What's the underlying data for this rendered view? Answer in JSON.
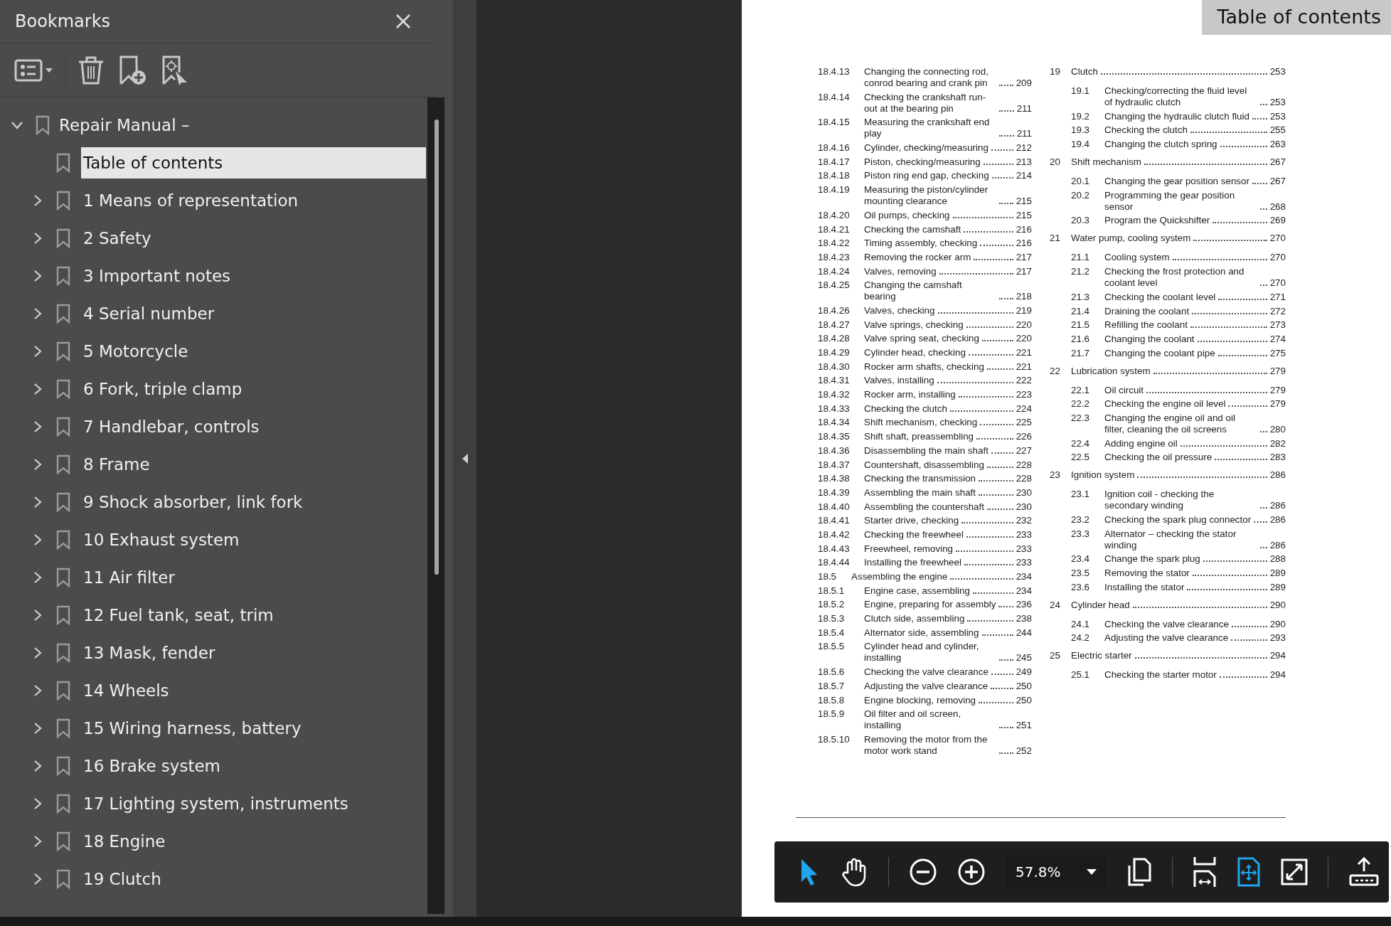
{
  "sidebar": {
    "title": "Bookmarks",
    "tree": [
      {
        "label": "Repair Manual –",
        "kind": "group",
        "expanded": true,
        "selected": false,
        "children": [
          {
            "label": "Table of contents",
            "kind": "leaf",
            "selected": true
          },
          {
            "label": "1 Means of representation",
            "kind": "group",
            "expanded": false,
            "selected": false
          },
          {
            "label": "2 Safety",
            "kind": "group",
            "expanded": false,
            "selected": false
          },
          {
            "label": "3 Important notes",
            "kind": "group",
            "expanded": false,
            "selected": false
          },
          {
            "label": "4 Serial number",
            "kind": "group",
            "expanded": false,
            "selected": false
          },
          {
            "label": "5 Motorcycle",
            "kind": "group",
            "expanded": false,
            "selected": false
          },
          {
            "label": "6 Fork, triple clamp",
            "kind": "group",
            "expanded": false,
            "selected": false
          },
          {
            "label": "7 Handlebar, controls",
            "kind": "group",
            "expanded": false,
            "selected": false
          },
          {
            "label": "8 Frame",
            "kind": "group",
            "expanded": false,
            "selected": false
          },
          {
            "label": "9 Shock absorber, link fork",
            "kind": "group",
            "expanded": false,
            "selected": false
          },
          {
            "label": "10 Exhaust system",
            "kind": "group",
            "expanded": false,
            "selected": false
          },
          {
            "label": "11 Air filter",
            "kind": "group",
            "expanded": false,
            "selected": false
          },
          {
            "label": "12 Fuel tank, seat, trim",
            "kind": "group",
            "expanded": false,
            "selected": false
          },
          {
            "label": "13 Mask, fender",
            "kind": "group",
            "expanded": false,
            "selected": false
          },
          {
            "label": "14 Wheels",
            "kind": "group",
            "expanded": false,
            "selected": false
          },
          {
            "label": "15 Wiring harness, battery",
            "kind": "group",
            "expanded": false,
            "selected": false
          },
          {
            "label": "16 Brake system",
            "kind": "group",
            "expanded": false,
            "selected": false
          },
          {
            "label": "17 Lighting system, instruments",
            "kind": "group",
            "expanded": false,
            "selected": false
          },
          {
            "label": "18 Engine",
            "kind": "group",
            "expanded": false,
            "selected": false
          },
          {
            "label": "19 Clutch",
            "kind": "group",
            "expanded": false,
            "selected": false
          }
        ]
      }
    ]
  },
  "document": {
    "page_tab": "Table of contents",
    "toc_left": [
      {
        "kind": "sub",
        "number": "18.4.13",
        "title": "Changing the connecting rod, conrod bearing and crank pin",
        "page": "209"
      },
      {
        "kind": "sub",
        "number": "18.4.14",
        "title": "Checking the crankshaft run-out at the bearing pin",
        "page": "211"
      },
      {
        "kind": "sub",
        "number": "18.4.15",
        "title": "Measuring the crankshaft end play",
        "page": "211"
      },
      {
        "kind": "sub",
        "number": "18.4.16",
        "title": "Cylinder, checking/measuring",
        "page": "212"
      },
      {
        "kind": "sub",
        "number": "18.4.17",
        "title": "Piston, checking/measuring",
        "page": "213"
      },
      {
        "kind": "sub",
        "number": "18.4.18",
        "title": "Piston ring end gap, checking",
        "page": "214"
      },
      {
        "kind": "sub",
        "number": "18.4.19",
        "title": "Measuring the piston/cylinder mounting clearance",
        "page": "215"
      },
      {
        "kind": "sub",
        "number": "18.4.20",
        "title": "Oil pumps, checking",
        "page": "215"
      },
      {
        "kind": "sub",
        "number": "18.4.21",
        "title": "Checking the camshaft",
        "page": "216"
      },
      {
        "kind": "sub",
        "number": "18.4.22",
        "title": "Timing assembly, checking",
        "page": "216"
      },
      {
        "kind": "sub",
        "number": "18.4.23",
        "title": "Removing the rocker arm",
        "page": "217"
      },
      {
        "kind": "sub",
        "number": "18.4.24",
        "title": "Valves, removing",
        "page": "217"
      },
      {
        "kind": "sub",
        "number": "18.4.25",
        "title": "Changing the camshaft bearing",
        "page": "218"
      },
      {
        "kind": "sub",
        "number": "18.4.26",
        "title": "Valves, checking",
        "page": "219"
      },
      {
        "kind": "sub",
        "number": "18.4.27",
        "title": "Valve springs, checking",
        "page": "220"
      },
      {
        "kind": "sub",
        "number": "18.4.28",
        "title": "Valve spring seat, checking",
        "page": "220"
      },
      {
        "kind": "sub",
        "number": "18.4.29",
        "title": "Cylinder head, checking",
        "page": "221"
      },
      {
        "kind": "sub",
        "number": "18.4.30",
        "title": "Rocker arm shafts, checking",
        "page": "221"
      },
      {
        "kind": "sub",
        "number": "18.4.31",
        "title": "Valves, installing",
        "page": "222"
      },
      {
        "kind": "sub",
        "number": "18.4.32",
        "title": "Rocker arm, installing",
        "page": "223"
      },
      {
        "kind": "sub",
        "number": "18.4.33",
        "title": "Checking the clutch",
        "page": "224"
      },
      {
        "kind": "sub",
        "number": "18.4.34",
        "title": "Shift mechanism, checking",
        "page": "225"
      },
      {
        "kind": "sub",
        "number": "18.4.35",
        "title": "Shift shaft, preassembling",
        "page": "226"
      },
      {
        "kind": "sub",
        "number": "18.4.36",
        "title": "Disassembling the main shaft",
        "page": "227"
      },
      {
        "kind": "sub",
        "number": "18.4.37",
        "title": "Countershaft, disassembling",
        "page": "228"
      },
      {
        "kind": "sub",
        "number": "18.4.38",
        "title": "Checking the transmission",
        "page": "228"
      },
      {
        "kind": "sub",
        "number": "18.4.39",
        "title": "Assembling the main shaft",
        "page": "230"
      },
      {
        "kind": "sub",
        "number": "18.4.40",
        "title": "Assembling the countershaft",
        "page": "230"
      },
      {
        "kind": "sub",
        "number": "18.4.41",
        "title": "Starter drive, checking",
        "page": "232"
      },
      {
        "kind": "sub",
        "number": "18.4.42",
        "title": "Checking the freewheel",
        "page": "233"
      },
      {
        "kind": "sub",
        "number": "18.4.43",
        "title": "Freewheel, removing",
        "page": "233"
      },
      {
        "kind": "sub",
        "number": "18.4.44",
        "title": "Installing the freewheel",
        "page": "233"
      },
      {
        "kind": "section",
        "number": "18.5",
        "title": "Assembling the engine",
        "page": "234"
      },
      {
        "kind": "sub",
        "number": "18.5.1",
        "title": "Engine case, assembling",
        "page": "234"
      },
      {
        "kind": "sub",
        "number": "18.5.2",
        "title": "Engine, preparing for assembly",
        "page": "236"
      },
      {
        "kind": "sub",
        "number": "18.5.3",
        "title": "Clutch side, assembling",
        "page": "238"
      },
      {
        "kind": "sub",
        "number": "18.5.4",
        "title": "Alternator side, assembling",
        "page": "244"
      },
      {
        "kind": "sub",
        "number": "18.5.5",
        "title": "Cylinder head and cylinder, installing",
        "page": "245"
      },
      {
        "kind": "sub",
        "number": "18.5.6",
        "title": "Checking the valve clearance",
        "page": "249"
      },
      {
        "kind": "sub",
        "number": "18.5.7",
        "title": "Adjusting the valve clearance",
        "page": "250"
      },
      {
        "kind": "sub",
        "number": "18.5.8",
        "title": "Engine blocking, removing",
        "page": "250"
      },
      {
        "kind": "sub",
        "number": "18.5.9",
        "title": "Oil filter and oil screen, installing",
        "page": "251"
      },
      {
        "kind": "sub",
        "number": "18.5.10",
        "title": "Removing the motor from the motor work stand",
        "page": "252"
      }
    ],
    "toc_right": [
      {
        "number": "19",
        "title": "Clutch",
        "page": "253",
        "children": [
          {
            "number": "19.1",
            "title": "Checking/correcting the fluid level of hydraulic clutch",
            "page": "253"
          },
          {
            "number": "19.2",
            "title": "Changing the hydraulic clutch fluid",
            "page": "253"
          },
          {
            "number": "19.3",
            "title": "Checking the clutch",
            "page": "255"
          },
          {
            "number": "19.4",
            "title": "Changing the clutch spring",
            "page": "263"
          }
        ]
      },
      {
        "number": "20",
        "title": "Shift mechanism",
        "page": "267",
        "children": [
          {
            "number": "20.1",
            "title": "Changing the gear position sensor",
            "page": "267"
          },
          {
            "number": "20.2",
            "title": "Programming the gear position sensor",
            "page": "268"
          },
          {
            "number": "20.3",
            "title": "Program the Quickshifter",
            "page": "269"
          }
        ]
      },
      {
        "number": "21",
        "title": "Water pump, cooling system",
        "page": "270",
        "children": [
          {
            "number": "21.1",
            "title": "Cooling system",
            "page": "270"
          },
          {
            "number": "21.2",
            "title": "Checking the frost protection and coolant level",
            "page": "270"
          },
          {
            "number": "21.3",
            "title": "Checking the coolant level",
            "page": "271"
          },
          {
            "number": "21.4",
            "title": "Draining the coolant",
            "page": "272"
          },
          {
            "number": "21.5",
            "title": "Refilling the coolant",
            "page": "273"
          },
          {
            "number": "21.6",
            "title": "Changing the coolant",
            "page": "274"
          },
          {
            "number": "21.7",
            "title": "Changing the coolant pipe",
            "page": "275"
          }
        ]
      },
      {
        "number": "22",
        "title": "Lubrication system",
        "page": "279",
        "children": [
          {
            "number": "22.1",
            "title": "Oil circuit",
            "page": "279"
          },
          {
            "number": "22.2",
            "title": "Checking the engine oil level",
            "page": "279"
          },
          {
            "number": "22.3",
            "title": "Changing the engine oil and oil filter, cleaning the oil screens",
            "page": "280"
          },
          {
            "number": "22.4",
            "title": "Adding engine oil",
            "page": "282"
          },
          {
            "number": "22.5",
            "title": "Checking the oil pressure",
            "page": "283"
          }
        ]
      },
      {
        "number": "23",
        "title": "Ignition system",
        "page": "286",
        "children": [
          {
            "number": "23.1",
            "title": "Ignition coil - checking the secondary winding",
            "page": "286"
          },
          {
            "number": "23.2",
            "title": "Checking the spark plug connector",
            "page": "286"
          },
          {
            "number": "23.3",
            "title": "Alternator – checking the stator winding",
            "page": "286"
          },
          {
            "number": "23.4",
            "title": "Change the spark plug",
            "page": "288"
          },
          {
            "number": "23.5",
            "title": "Removing the stator",
            "page": "289"
          },
          {
            "number": "23.6",
            "title": "Installing the stator",
            "page": "289"
          }
        ]
      },
      {
        "number": "24",
        "title": "Cylinder head",
        "page": "290",
        "children": [
          {
            "number": "24.1",
            "title": "Checking the valve clearance",
            "page": "290"
          },
          {
            "number": "24.2",
            "title": "Adjusting the valve clearance",
            "page": "293"
          }
        ]
      },
      {
        "number": "25",
        "title": "Electric starter",
        "page": "294",
        "children": [
          {
            "number": "25.1",
            "title": "Checking the starter motor",
            "page": "294"
          }
        ]
      }
    ]
  },
  "toolbar": {
    "tools": [
      {
        "kind": "pointer",
        "selected": true
      },
      {
        "kind": "hand",
        "selected": false
      }
    ],
    "zoom": "57.8%",
    "views": [
      {
        "kind": "pages",
        "selected": false
      },
      {
        "kind": "fit-width",
        "selected": false
      },
      {
        "kind": "fit-page",
        "selected": true
      },
      {
        "kind": "full-screen",
        "selected": false
      }
    ]
  }
}
